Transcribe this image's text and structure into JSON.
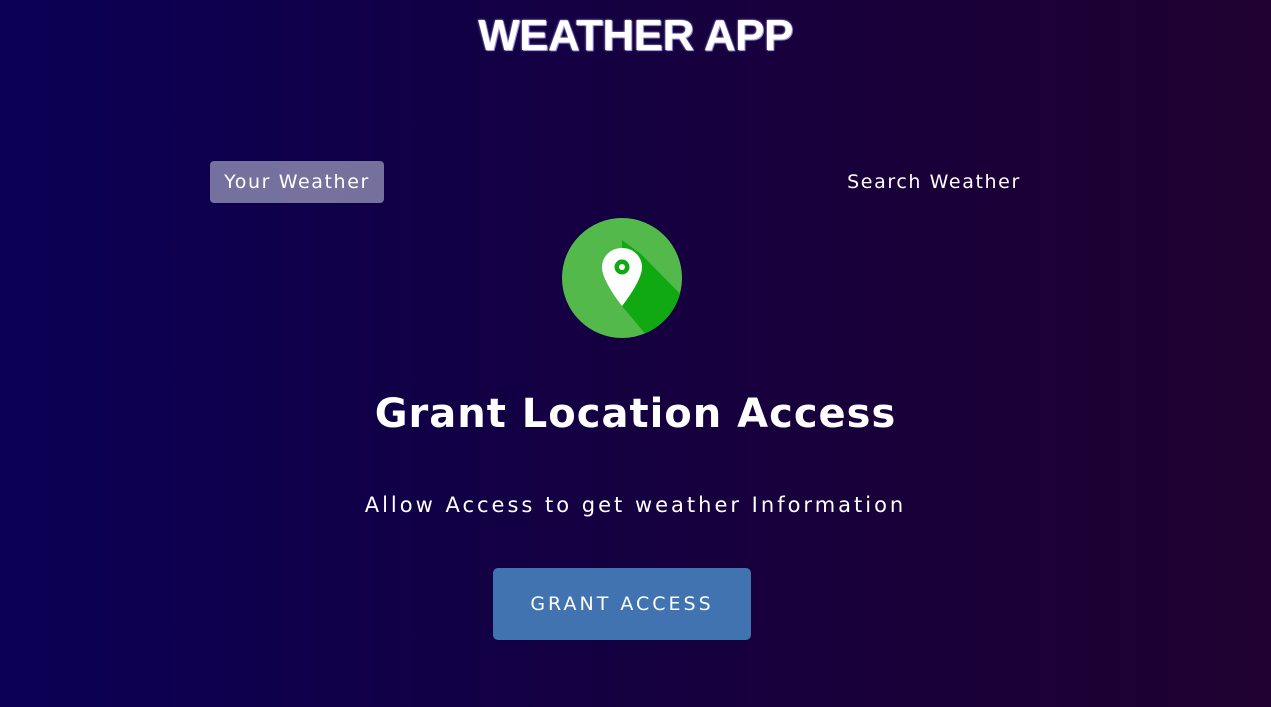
{
  "app": {
    "title": "WEATHER APP"
  },
  "tabs": {
    "your_weather": "Your Weather",
    "search_weather": "Search Weather",
    "active": "your_weather"
  },
  "grant": {
    "icon": "location-pin-icon",
    "heading": "Grant Location Access",
    "description": "Allow Access to get weather Information",
    "button_label": "GRANT ACCESS"
  },
  "colors": {
    "bg_left": "#0b0055",
    "bg_right": "#1f0030",
    "icon_green": "#54b94b",
    "icon_shadow_green": "#11a911",
    "button_blue": "#4073af",
    "active_tab_bg": "rgba(219,226,239,0.5)"
  }
}
